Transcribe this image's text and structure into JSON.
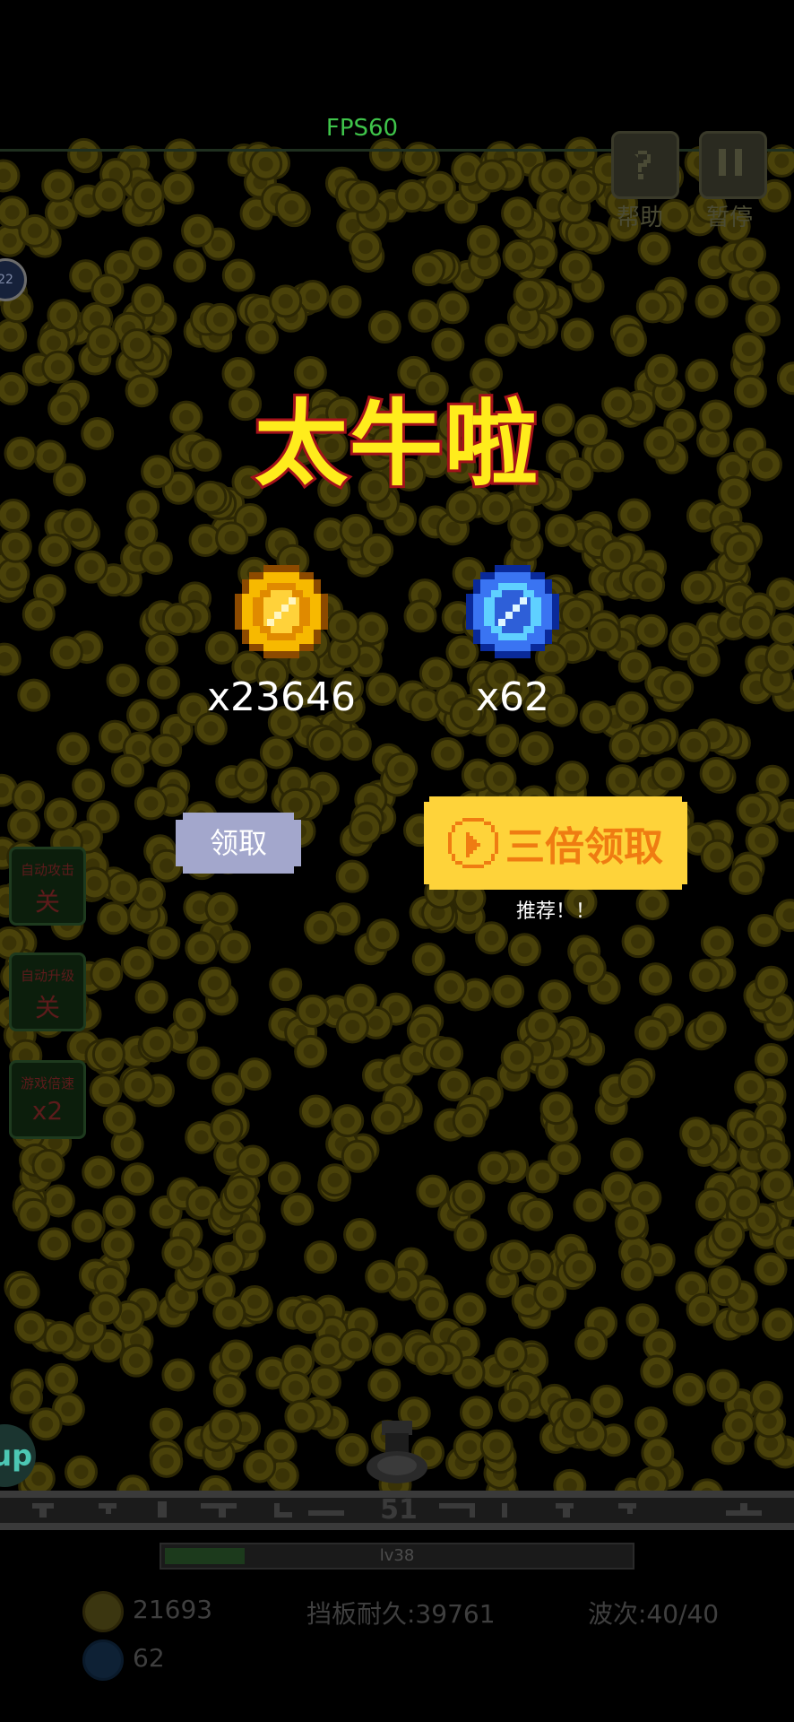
{
  "hud": {
    "fps": "FPS60",
    "help_label": "帮助",
    "pause_label": "暂停",
    "orb_label": "22",
    "xp_orb_label": "up"
  },
  "side_buttons": [
    {
      "line1": "自动攻击",
      "line2": "关"
    },
    {
      "line1": "自动升级",
      "line2": "关"
    },
    {
      "line1": "游戏倍速",
      "line2": "x2"
    }
  ],
  "reward_popup": {
    "title": "太牛啦",
    "gold_count": "x23646",
    "gem_count": "x62",
    "claim_label": "领取",
    "triple_claim_label": "三倍领取",
    "recommend_text": "推荐！！"
  },
  "wall": {
    "number": "51"
  },
  "level_bar": {
    "label": "lv38",
    "progress": 0.17
  },
  "stats": {
    "gold": "21693",
    "barrier": "挡板耐久:39761",
    "wave": "波次:40/40",
    "gems": "62"
  },
  "colors": {
    "title_fill": "#ffec1c",
    "title_stroke": "#a3121a",
    "triple_button": "#fed33a",
    "triple_text": "#ef7c12",
    "claim_button": "#a3a7cc",
    "fps_text": "#3fc44a",
    "dim_coin": "#57500b"
  }
}
